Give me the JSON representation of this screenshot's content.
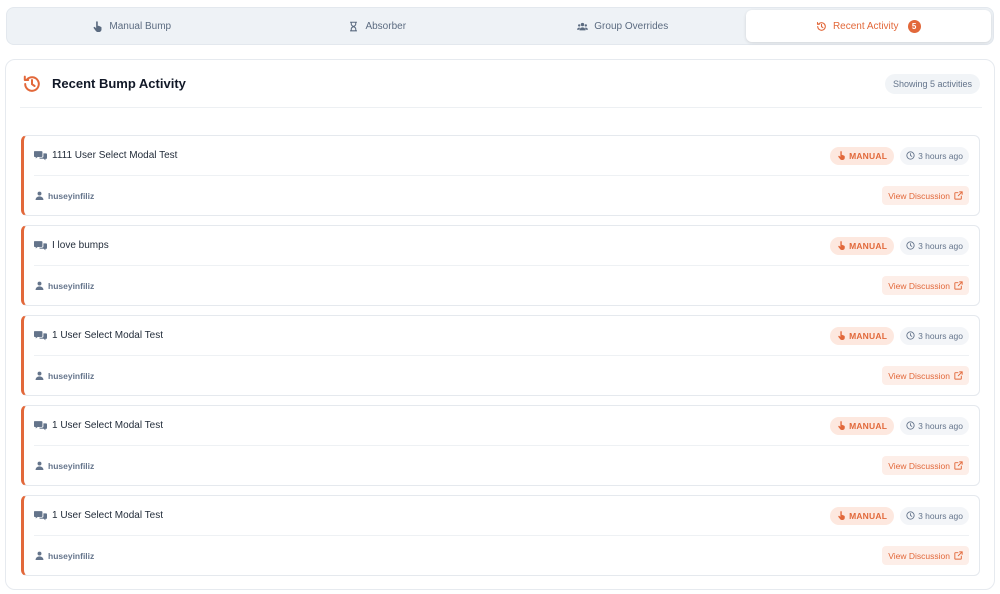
{
  "tabs": [
    {
      "label": "Manual Bump",
      "icon": "pointer-hand-icon",
      "active": false
    },
    {
      "label": "Absorber",
      "icon": "hourglass-icon",
      "active": false
    },
    {
      "label": "Group Overrides",
      "icon": "users-group-icon",
      "active": false
    },
    {
      "label": "Recent Activity",
      "icon": "history-icon",
      "active": true,
      "badge": "5"
    }
  ],
  "panel": {
    "title": "Recent Bump Activity",
    "count_label": "Showing 5 activities"
  },
  "activities": [
    {
      "title": "1111 User Select Modal Test",
      "type": "MANUAL",
      "time": "3 hours ago",
      "user": "huseyinfiliz",
      "action": "View Discussion"
    },
    {
      "title": "I love bumps",
      "type": "MANUAL",
      "time": "3 hours ago",
      "user": "huseyinfiliz",
      "action": "View Discussion"
    },
    {
      "title": "1 User Select Modal Test",
      "type": "MANUAL",
      "time": "3 hours ago",
      "user": "huseyinfiliz",
      "action": "View Discussion"
    },
    {
      "title": "1 User Select Modal Test",
      "type": "MANUAL",
      "time": "3 hours ago",
      "user": "huseyinfiliz",
      "action": "View Discussion"
    },
    {
      "title": "1 User Select Modal Test",
      "type": "MANUAL",
      "time": "3 hours ago",
      "user": "huseyinfiliz",
      "action": "View Discussion"
    }
  ],
  "colors": {
    "accent": "#e2683a",
    "muted": "#64748b",
    "badge_bg": "#fde8df"
  }
}
